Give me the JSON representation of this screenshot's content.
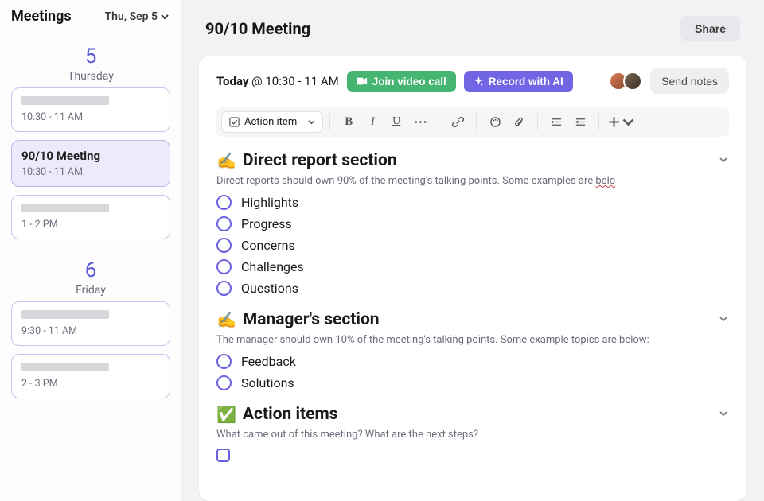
{
  "sidebar": {
    "title": "Meetings",
    "date_picker": "Thu, Sep 5",
    "days": [
      {
        "number": "5",
        "name": "Thursday",
        "meetings": [
          {
            "placeholder": true,
            "time": "10:30 - 11 AM"
          },
          {
            "title": "90/10 Meeting",
            "time": "10:30 - 11 AM",
            "selected": true
          },
          {
            "placeholder": true,
            "time": "1 - 2 PM"
          }
        ]
      },
      {
        "number": "6",
        "name": "Friday",
        "meetings": [
          {
            "placeholder": true,
            "time": "9:30 - 11 AM"
          },
          {
            "placeholder": true,
            "time": "2 - 3 PM"
          }
        ]
      }
    ]
  },
  "main": {
    "title": "90/10 Meeting",
    "share": "Share",
    "today_label": "Today",
    "time_range": "10:30 - 11 AM",
    "join_label": "Join video call",
    "record_label": "Record with AI",
    "send_label": "Send notes",
    "toolbar": {
      "dropdown_label": "Action item"
    },
    "sections": [
      {
        "emoji": "✍️",
        "title": "Direct report section",
        "desc_pre": "Direct reports should own 90% of the meeting's talking points. Some examples are ",
        "desc_typo": "belo",
        "items": [
          "Highlights",
          "Progress",
          "Concerns",
          "Challenges",
          "Questions"
        ]
      },
      {
        "emoji": "✍️",
        "title": "Manager's section",
        "desc": "The manager should own 10% of the meeting's talking points. Some example topics are below:",
        "items": [
          "Feedback",
          "Solutions"
        ]
      },
      {
        "emoji": "✅",
        "title": "Action items",
        "desc": "What came out of this meeting? What are the next steps?",
        "square": true,
        "items": [
          ""
        ]
      }
    ]
  }
}
